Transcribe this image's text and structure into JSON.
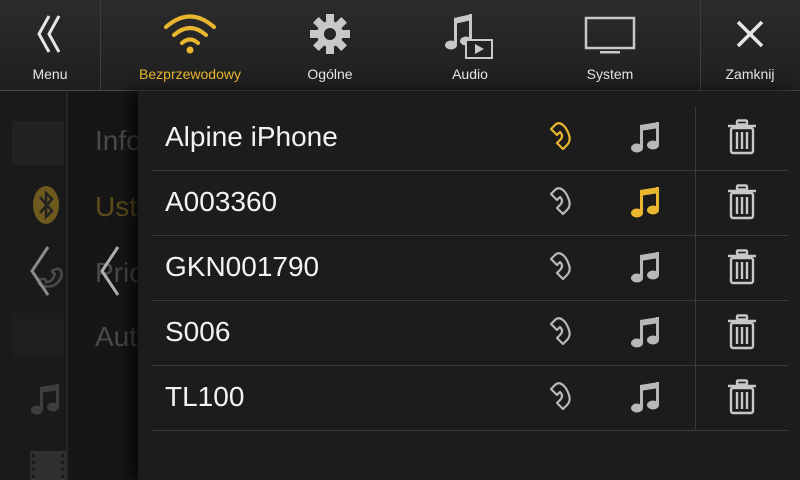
{
  "topbar": {
    "menu_label": "Menu",
    "tabs": [
      {
        "label": "Bezprzewodowy",
        "icon": "wifi-icon",
        "active": true
      },
      {
        "label": "Ogólne",
        "icon": "gear-icon",
        "active": false
      },
      {
        "label": "Audio",
        "icon": "music-video-icon",
        "active": false
      },
      {
        "label": "System",
        "icon": "monitor-icon",
        "active": false
      }
    ],
    "close_label": "Zamknij"
  },
  "background_menu": {
    "items": [
      "Info",
      "Ust",
      "Prio",
      "Aut"
    ]
  },
  "devices": [
    {
      "name": "Alpine iPhone",
      "phone_active": true,
      "music_active": false
    },
    {
      "name": "A003360",
      "phone_active": false,
      "music_active": true
    },
    {
      "name": "GKN001790",
      "phone_active": false,
      "music_active": false
    },
    {
      "name": "S006",
      "phone_active": false,
      "music_active": false
    },
    {
      "name": "TL100",
      "phone_active": false,
      "music_active": false
    }
  ],
  "colors": {
    "accent": "#e9b62f",
    "inactive_icon": "#b8b8b8",
    "text": "#f2f2f2"
  }
}
